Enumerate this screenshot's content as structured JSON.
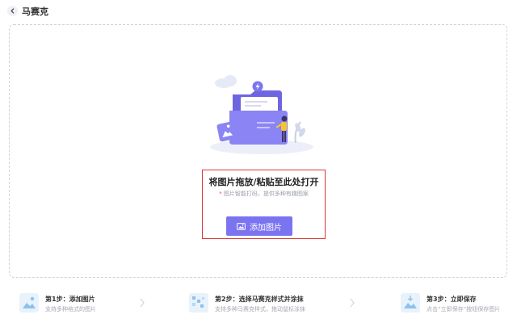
{
  "header": {
    "title": "马赛克",
    "back_icon": "chevron-left-icon"
  },
  "upload": {
    "title": "将图片拖放/粘贴至此处打开",
    "hint_star": "*",
    "hint": "图片智能打码，提供多种有趣图案",
    "button_label": "添加图片",
    "button_icon": "image-icon",
    "accent": "#7b74f0",
    "highlight_border": "#d93a36"
  },
  "steps": [
    {
      "title": "第1步：添加图片",
      "desc": "支持多种格式的图片",
      "icon": "image-add-icon"
    },
    {
      "title": "第2步：选择马赛克样式并涂抹",
      "desc": "支持多种马赛克样式，拖动鼠标涂抹",
      "icon": "mosaic-brush-icon"
    },
    {
      "title": "第3步：立即保存",
      "desc": "点击“立即保存”按钮保存图片",
      "icon": "save-image-icon"
    }
  ]
}
